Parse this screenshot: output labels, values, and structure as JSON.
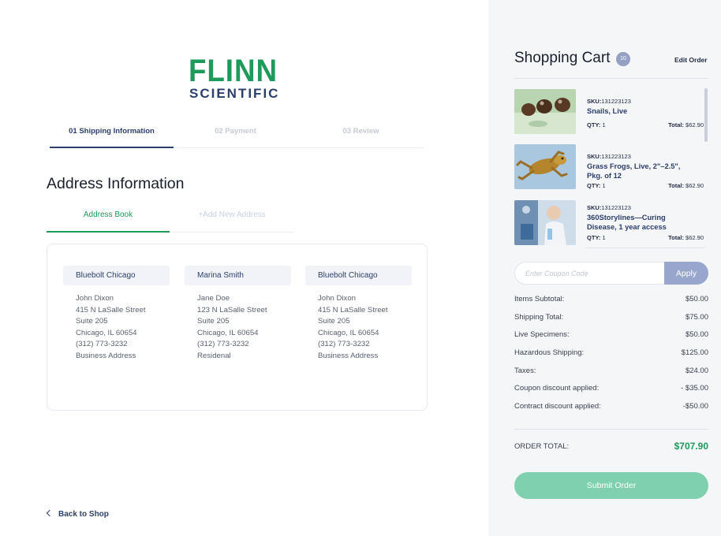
{
  "brand": {
    "logo_top": "FLINN",
    "logo_bottom": "SCIENTIFIC"
  },
  "steps": [
    {
      "label": "01 Shipping Information",
      "active": true
    },
    {
      "label": "02 Payment",
      "active": false
    },
    {
      "label": "03 Review",
      "active": false
    }
  ],
  "address_section": {
    "title": "Address Information",
    "tabs": [
      {
        "label": "Address Book",
        "active": true
      },
      {
        "label": "+Add New Address",
        "active": false
      }
    ],
    "cards": [
      {
        "name": "Bluebolt Chicago",
        "person": "John Dixon",
        "street": "415 N LaSalle Street",
        "unit": "Suite 205",
        "city": "Chicago, IL 60654",
        "phone": "(312) 773-3232",
        "type": "Business Address"
      },
      {
        "name": "Marina Smith",
        "person": "Jane Doe",
        "street": "123 N LaSalle Street",
        "unit": "Suite 205",
        "city": "Chicago, IL 60654",
        "phone": "(312) 773-3232",
        "type": "Residenal"
      },
      {
        "name": "Bluebolt Chicago",
        "person": "John Dixon",
        "street": "415 N LaSalle Street",
        "unit": "Suite 205",
        "city": "Chicago, IL 60654",
        "phone": "(312) 773-3232",
        "type": "Business Address"
      }
    ]
  },
  "back_link": "Back to Shop",
  "cart": {
    "title": "Shopping Cart",
    "count": "10",
    "edit_label": "Edit Order",
    "sku_prefix": "SKU:",
    "qty_prefix": "QTY: ",
    "total_prefix": "Total: ",
    "items": [
      {
        "sku": "131223123",
        "title": "Snails, Live",
        "qty": "1",
        "total": "$62.90",
        "image": "snails"
      },
      {
        "sku": "131223123",
        "title": "Grass Frogs, Live, 2\"–2.5\", Pkg. of 12",
        "qty": "1",
        "total": "$62.90",
        "image": "frog"
      },
      {
        "sku": "131223123",
        "title": "360Storylines—Curing Disease, 1 year access",
        "qty": "1",
        "total": "$62.90",
        "image": "lab"
      }
    ],
    "coupon": {
      "placeholder": "Enter Coupon Code",
      "apply_label": "Apply"
    },
    "summary": [
      {
        "label": "Items Subtotal:",
        "value": "$50.00"
      },
      {
        "label": "Shipping Total:",
        "value": "$75.00"
      },
      {
        "label": "Live Specimens:",
        "value": "$50.00"
      },
      {
        "label": "Hazardous Shipping:",
        "value": "$125.00"
      },
      {
        "label": "Taxes:",
        "value": "$24.00"
      },
      {
        "label": "Coupon discount applied:",
        "value": "- $35.00"
      },
      {
        "label": "Contract discount applied:",
        "value": "-$50.00"
      }
    ],
    "order_total_label": "ORDER TOTAL:",
    "order_total_value": "$707.90",
    "submit_label": "Submit Order"
  },
  "colors": {
    "brand_green": "#1e9a5a",
    "navy": "#2b3f6b",
    "apply_bg": "#98a5cc",
    "submit_bg": "#7fd0ae"
  }
}
